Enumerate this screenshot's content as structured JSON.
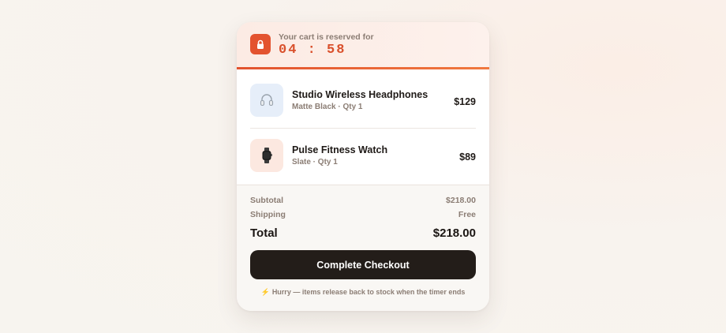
{
  "timer": {
    "label": "Your cart is reserved for",
    "countdown": "04 : 58",
    "icon": "lock-icon",
    "accent_color": "#e3532f"
  },
  "cart": {
    "items": [
      {
        "name": "Studio Wireless Headphones",
        "meta": "Matte Black · Qty 1",
        "price": "$129",
        "icon": "headphones-icon"
      },
      {
        "name": "Pulse Fitness Watch",
        "meta": "Slate · Qty 1",
        "price": "$89",
        "icon": "watch-icon"
      }
    ]
  },
  "summary": {
    "subtotal_label": "Subtotal",
    "subtotal_value": "$218.00",
    "shipping_label": "Shipping",
    "shipping_value": "Free",
    "total_label": "Total",
    "total_value": "$218.00"
  },
  "checkout": {
    "button_label": "Complete Checkout",
    "note": "Hurry — items release back to stock when the timer ends",
    "note_icon": "lightning-icon"
  }
}
